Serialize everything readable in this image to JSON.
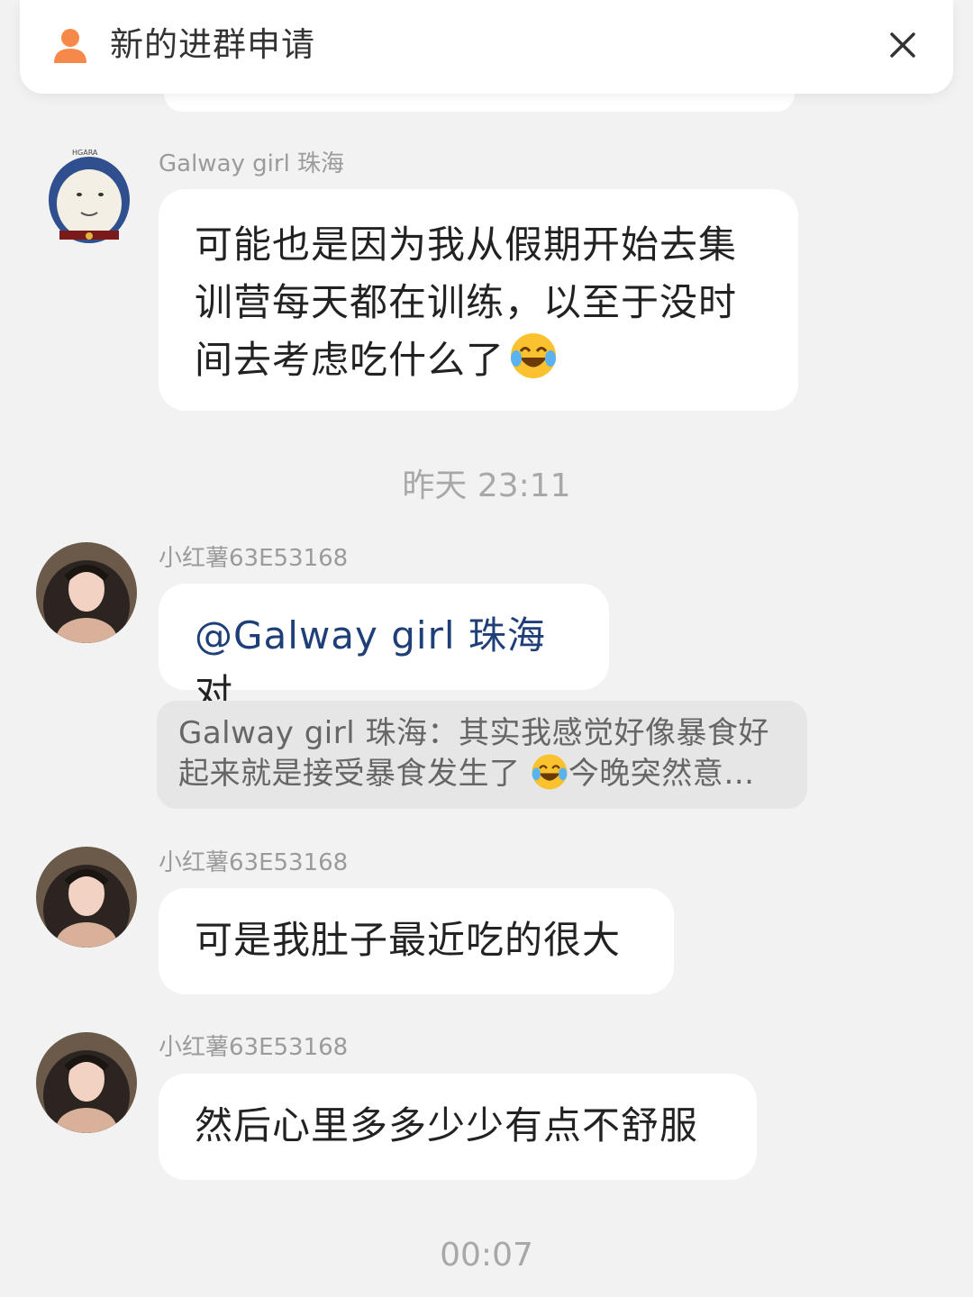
{
  "banner": {
    "title": "新的进群申请",
    "icon": "person-icon",
    "close_icon": "close-icon",
    "accent": "#f6894a"
  },
  "messages": [
    {
      "sender": "Galway girl 珠海",
      "text": "可能也是因为我从假期开始去集训营每天都在训练，以至于没时间去考虑吃什么了",
      "emoji": "laughing-tears-emoji"
    },
    {
      "sender": "小红薯63E53168",
      "mention": "@Galway girl 珠海",
      "text": "对",
      "quote_author": "Galway girl 珠海：",
      "quote_text_a": "其实我感觉好像暴食好起来就是接受暴食发生了",
      "quote_text_b": "今晚突然意…",
      "quote_emoji": "laughing-tears-emoji"
    },
    {
      "sender": "小红薯63E53168",
      "text": "可是我肚子最近吃的很大"
    },
    {
      "sender": "小红薯63E53168",
      "text": "然后心里多多少少有点不舒服"
    }
  ],
  "timestamps": [
    "昨天 23:11",
    "00:07"
  ],
  "colors": {
    "background": "#f2f2f2",
    "bubble": "#ffffff",
    "quote_bg": "#e6e6e6",
    "mention": "#1f3f78",
    "meta_text": "#9b9b9b"
  }
}
